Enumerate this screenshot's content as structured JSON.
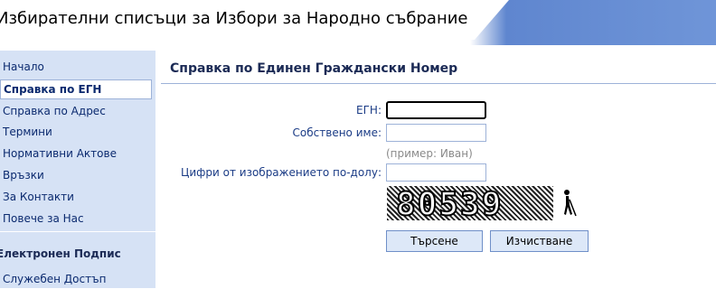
{
  "header": {
    "title": "Избирателни списъци за Избори за Народно събрание"
  },
  "sidebar": {
    "items": [
      {
        "label": "Начало"
      },
      {
        "label": "Справка по ЕГН"
      },
      {
        "label": "Справка по Адрес"
      },
      {
        "label": "Термини"
      },
      {
        "label": "Нормативни Актове"
      },
      {
        "label": "Връзки"
      },
      {
        "label": "За Контакти"
      },
      {
        "label": "Повече за Нас"
      }
    ],
    "section_title": "Електронен Подпис",
    "section_items": [
      {
        "label": "Служебен Достъп"
      }
    ],
    "active_index": 1
  },
  "main": {
    "title": "Справка по Единен Граждански Номер",
    "form": {
      "egn_label": "ЕГН:",
      "egn_value": "",
      "name_label": "Собствено име:",
      "name_value": "",
      "name_hint": "(пример: Иван)",
      "captcha_label": "Цифри от изображението по-долу:",
      "captcha_value": "",
      "captcha_digits": "80539",
      "search_button": "Търсене",
      "clear_button": "Изчистване"
    }
  },
  "colors": {
    "header_band": "#6f95d8",
    "sidebar_bg": "#d6e2f5",
    "link_text": "#0b2a6f",
    "label_text": "#1b3c86",
    "button_bg": "#dde8f8"
  },
  "icons": {
    "audio_captcha": "accessibility-walking-icon"
  }
}
